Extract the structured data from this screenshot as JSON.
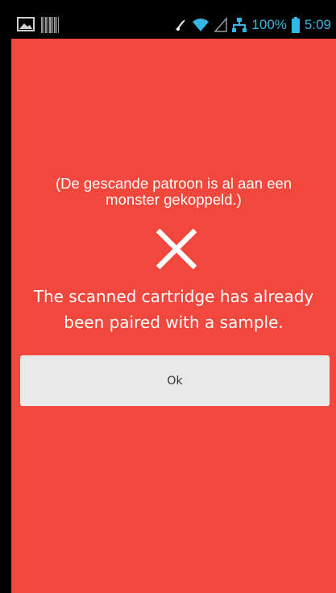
{
  "status_bar": {
    "left_icons": [
      "image-icon",
      "barcode-icon"
    ],
    "right_icons": [
      "mute-icon",
      "wifi-icon",
      "signal-icon",
      "network-icon",
      "battery-icon"
    ],
    "battery_percent": "100%",
    "time": "5:09",
    "accent_color": "#33b5e5"
  },
  "dialog": {
    "background_color": "#f2473c",
    "dutch_message": "(De gescande patroon is al aan een\nmonster gekoppeld.)",
    "status_icon": "close-x-icon",
    "english_message": "The scanned cartridge has already\nbeen paired with a sample.",
    "ok_label": "Ok"
  }
}
